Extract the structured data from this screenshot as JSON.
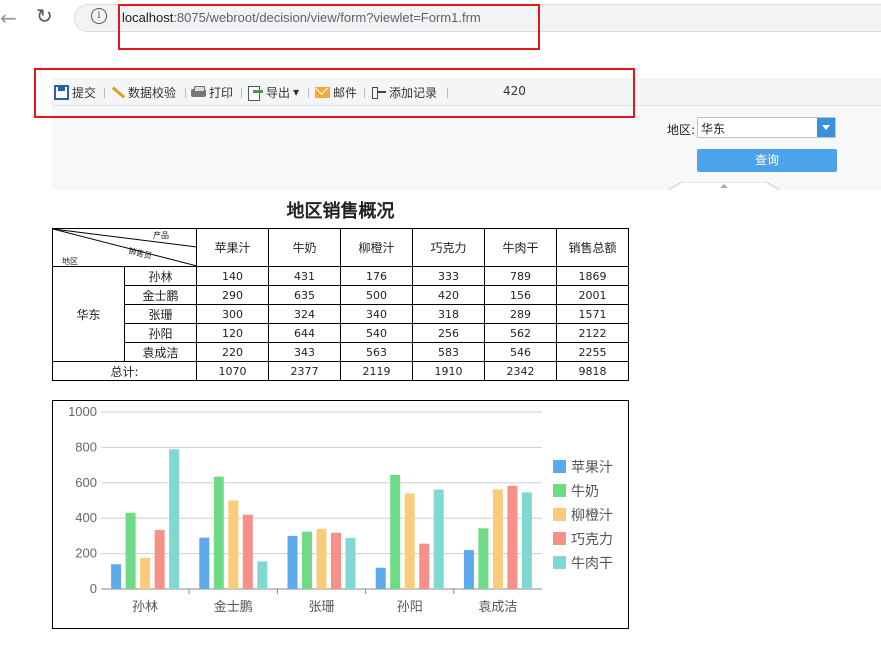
{
  "browser": {
    "url_host": "localhost",
    "url_rest": ":8075/webroot/decision/view/form?viewlet=Form1.frm"
  },
  "toolbar": {
    "submit": "提交",
    "validate": "数据校验",
    "print": "打印",
    "export": "导出",
    "email": "邮件",
    "add_record": "添加记录",
    "counter": "420"
  },
  "params": {
    "region_label": "地区:",
    "region_value": "华东",
    "query_label": "查询"
  },
  "report": {
    "title": "地区销售概况",
    "corner_labels": {
      "product": "产品",
      "salesperson": "销售员",
      "region": "地区"
    },
    "columns": [
      "苹果汁",
      "牛奶",
      "柳橙汁",
      "巧克力",
      "牛肉干",
      "销售总额"
    ],
    "region": "华东",
    "rows": [
      {
        "name": "孙林",
        "values": [
          "140",
          "431",
          "176",
          "333",
          "789",
          "1869"
        ]
      },
      {
        "name": "金士鹏",
        "values": [
          "290",
          "635",
          "500",
          "420",
          "156",
          "2001"
        ]
      },
      {
        "name": "张珊",
        "values": [
          "300",
          "324",
          "340",
          "318",
          "289",
          "1571"
        ]
      },
      {
        "name": "孙阳",
        "values": [
          "120",
          "644",
          "540",
          "256",
          "562",
          "2122"
        ]
      },
      {
        "name": "袁成洁",
        "values": [
          "220",
          "343",
          "563",
          "583",
          "546",
          "2255"
        ]
      }
    ],
    "total_label": "总计:",
    "totals": [
      "1070",
      "2377",
      "2119",
      "1910",
      "2342",
      "9818"
    ]
  },
  "chart_data": {
    "type": "bar",
    "categories": [
      "孙林",
      "金士鹏",
      "张珊",
      "孙阳",
      "袁成洁"
    ],
    "series": [
      {
        "name": "苹果汁",
        "color": "#5da9ec",
        "values": [
          140,
          290,
          300,
          120,
          220
        ]
      },
      {
        "name": "牛奶",
        "color": "#6fdb86",
        "values": [
          431,
          635,
          324,
          644,
          343
        ]
      },
      {
        "name": "柳橙汁",
        "color": "#f8cc7a",
        "values": [
          176,
          500,
          340,
          540,
          563
        ]
      },
      {
        "name": "巧克力",
        "color": "#f59187",
        "values": [
          333,
          420,
          318,
          256,
          583
        ]
      },
      {
        "name": "牛肉干",
        "color": "#7fd9d0",
        "values": [
          789,
          156,
          289,
          562,
          546
        ]
      }
    ],
    "ylim": [
      0,
      1000
    ],
    "yticks": [
      "0",
      "200",
      "400",
      "600",
      "800",
      "1000"
    ],
    "grid": true,
    "legend": "right"
  }
}
